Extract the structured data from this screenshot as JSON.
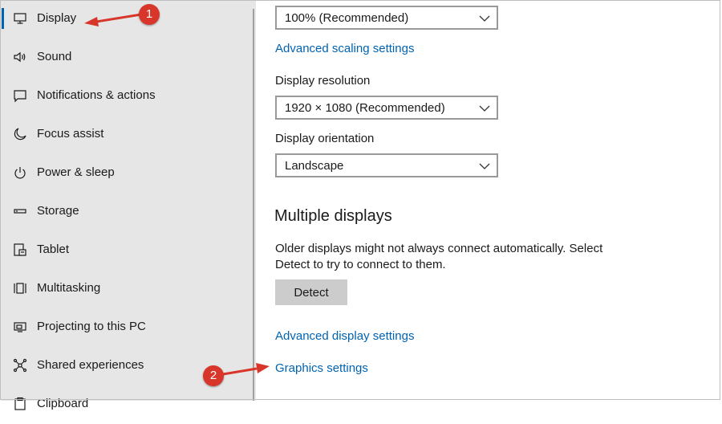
{
  "sidebar": {
    "items": [
      {
        "label": "Display",
        "icon": "monitor-icon",
        "selected": true
      },
      {
        "label": "Sound",
        "icon": "speaker-icon"
      },
      {
        "label": "Notifications & actions",
        "icon": "notification-icon"
      },
      {
        "label": "Focus assist",
        "icon": "moon-icon"
      },
      {
        "label": "Power & sleep",
        "icon": "power-icon"
      },
      {
        "label": "Storage",
        "icon": "storage-icon"
      },
      {
        "label": "Tablet",
        "icon": "tablet-icon"
      },
      {
        "label": "Multitasking",
        "icon": "multitasking-icon"
      },
      {
        "label": "Projecting to this PC",
        "icon": "projecting-icon"
      },
      {
        "label": "Shared experiences",
        "icon": "shared-icon"
      },
      {
        "label": "Clipboard",
        "icon": "clipboard-icon"
      }
    ]
  },
  "main": {
    "scale_select": {
      "value": "100% (Recommended)"
    },
    "advanced_scaling_link": "Advanced scaling settings",
    "resolution_label": "Display resolution",
    "resolution_select": {
      "value": "1920 × 1080 (Recommended)"
    },
    "orientation_label": "Display orientation",
    "orientation_select": {
      "value": "Landscape"
    },
    "multiple_displays_title": "Multiple displays",
    "multiple_displays_desc": "Older displays might not always connect automatically. Select Detect to try to connect to them.",
    "detect_button": "Detect",
    "advanced_display_link": "Advanced display settings",
    "graphics_settings_link": "Graphics settings"
  },
  "annotations": {
    "badge1": "1",
    "badge2": "2",
    "color": "#d9362b"
  },
  "colors": {
    "accent": "#0063b1",
    "sidebar_bg": "#e6e6e6"
  }
}
